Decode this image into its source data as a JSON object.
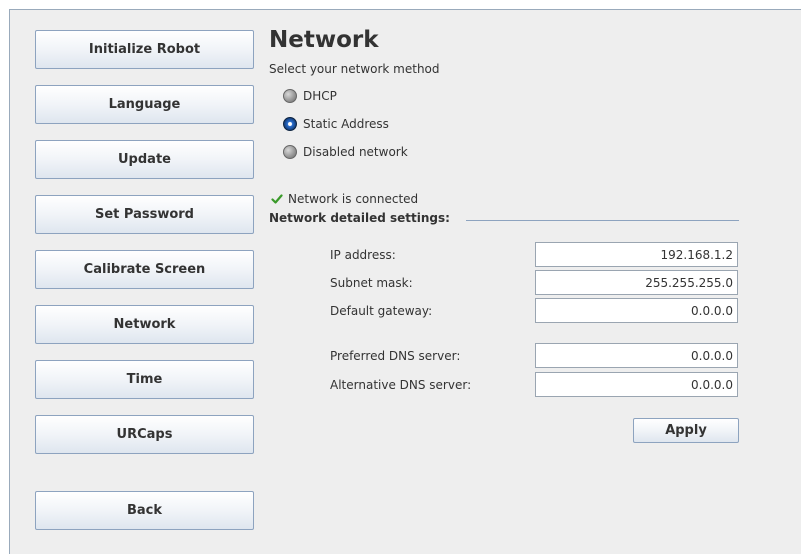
{
  "sidebar": {
    "items": [
      {
        "label": "Initialize Robot"
      },
      {
        "label": "Language"
      },
      {
        "label": "Update"
      },
      {
        "label": "Set Password"
      },
      {
        "label": "Calibrate Screen"
      },
      {
        "label": "Network"
      },
      {
        "label": "Time"
      },
      {
        "label": "URCaps"
      }
    ],
    "back_label": "Back"
  },
  "main": {
    "title": "Network",
    "subtitle": "Select your network method",
    "methods": [
      {
        "label": "DHCP",
        "checked": false
      },
      {
        "label": "Static Address",
        "checked": true
      },
      {
        "label": "Disabled network",
        "checked": false
      }
    ],
    "status": {
      "icon": "check-icon",
      "text": "Network is connected",
      "color": "#3a9a2a"
    },
    "section_label": "Network detailed settings:",
    "fields": [
      {
        "label": "IP address:",
        "value": "192.168.1.2"
      },
      {
        "label": "Subnet mask:",
        "value": "255.255.255.0"
      },
      {
        "label": "Default gateway:",
        "value": "0.0.0.0"
      },
      {
        "label": "Preferred DNS server:",
        "value": "0.0.0.0"
      },
      {
        "label": "Alternative DNS server:",
        "value": "0.0.0.0"
      }
    ],
    "apply_label": "Apply"
  },
  "colors": {
    "background": "#eeeeee",
    "button_border": "#8da3bf",
    "radio_selected": "#15407e"
  }
}
